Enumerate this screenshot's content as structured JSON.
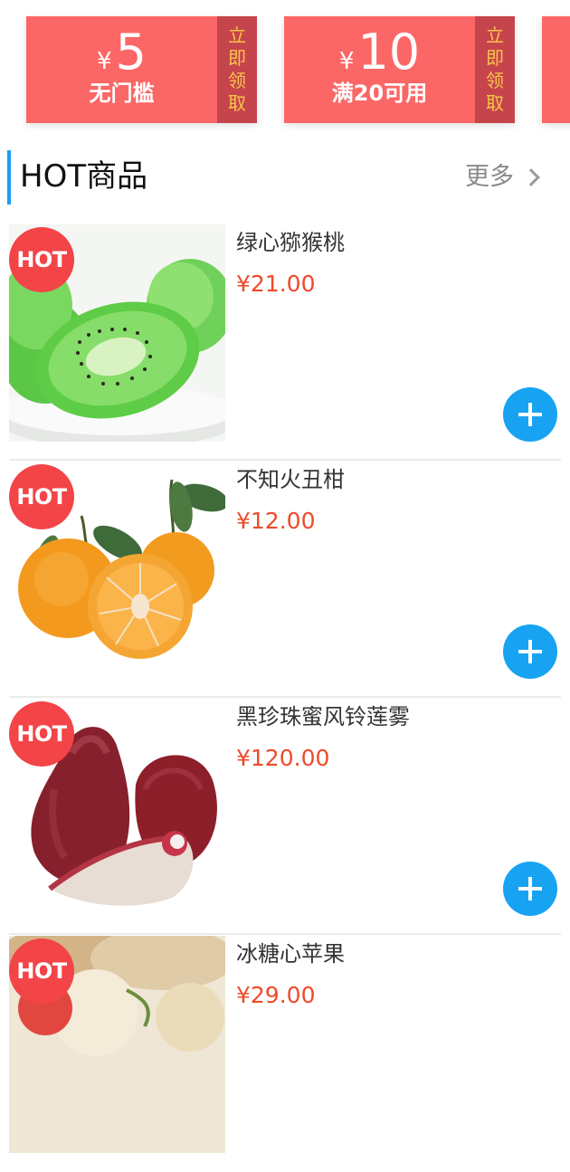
{
  "coupons": [
    {
      "currency": "¥",
      "amount": "5",
      "condition": "无门槛",
      "claim": [
        "立",
        "即",
        "领",
        "取"
      ]
    },
    {
      "currency": "¥",
      "amount": "10",
      "condition": "满20可用",
      "claim": [
        "立",
        "即",
        "领",
        "取"
      ]
    }
  ],
  "section": {
    "title": "HOT商品",
    "more": "更多"
  },
  "products": [
    {
      "badge": "HOT",
      "name": "绿心猕猴桃",
      "price": "¥21.00",
      "image": "kiwi-image"
    },
    {
      "badge": "HOT",
      "name": "不知火丑柑",
      "price": "¥12.00",
      "image": "orange-image"
    },
    {
      "badge": "HOT",
      "name": "黑珍珠蜜风铃莲雾",
      "price": "¥120.00",
      "image": "wax-apple-image"
    },
    {
      "badge": "HOT",
      "name": "冰糖心苹果",
      "price": "¥29.00",
      "image": "apple-image"
    }
  ],
  "colors": {
    "coupon": "#fb6766",
    "coupon_side": "#c6444c",
    "accent_blue": "#17a3f2",
    "hot": "#f34448",
    "price": "#ee4a2a"
  },
  "icons": [
    "chevron-right-icon",
    "plus-icon"
  ]
}
